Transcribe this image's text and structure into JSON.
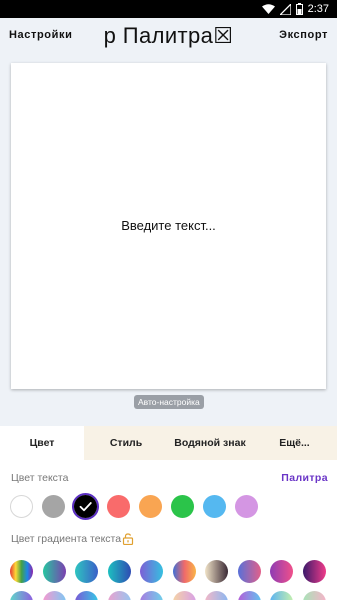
{
  "status_bar": {
    "time": "2:37"
  },
  "header": {
    "settings_label": "Настройки",
    "title": "р  Палитра☒",
    "export_label": "Экспорт"
  },
  "canvas": {
    "placeholder": "Введите текст...",
    "auto_badge": "Авто-настройка"
  },
  "tabs": [
    {
      "label": "Цвет",
      "active": true
    },
    {
      "label": "Стиль",
      "active": false
    },
    {
      "label": "Водяной знак",
      "active": false
    },
    {
      "label": "Ещё...",
      "active": false
    }
  ],
  "panel": {
    "text_color_label": "Цвет текста",
    "palette_link": "Палитра",
    "gradient_label": "Цвет градиента текста",
    "colors": [
      {
        "name": "white",
        "hex": "#ffffff"
      },
      {
        "name": "gray",
        "hex": "#a5a5a5"
      },
      {
        "name": "black",
        "hex": "#000000",
        "selected": true
      },
      {
        "name": "red",
        "hex": "#f96b6b"
      },
      {
        "name": "orange",
        "hex": "#f9a552"
      },
      {
        "name": "green",
        "hex": "#2bc44a"
      },
      {
        "name": "blue",
        "hex": "#55b8f0"
      },
      {
        "name": "lilac",
        "hex": "#d496e3"
      }
    ],
    "gradients_row1": [
      [
        "#e53935",
        "#fdd835",
        "#43a047",
        "#1e88e5",
        "#8e24aa"
      ],
      [
        "#26c6a0",
        "#7b3fb0"
      ],
      [
        "#2ec5c0",
        "#3a5fc8"
      ],
      [
        "#1dc0c0",
        "#2f4bb3"
      ],
      [
        "#7d5fd6",
        "#35c0e0"
      ],
      [
        "#3f6fd6",
        "#f06a6a",
        "#f9b548"
      ],
      [
        "#f1e3c8",
        "#3a2a35"
      ],
      [
        "#5870d8",
        "#e2608a"
      ],
      [
        "#8e3cb4",
        "#f0508a"
      ],
      [
        "#3b1a6a",
        "#f03b8a"
      ]
    ],
    "gradients_row2": [
      [
        "#5fd6c8",
        "#8e5fe0"
      ],
      [
        "#f59ad0",
        "#7fc6f2"
      ],
      [
        "#7a5ad6",
        "#35c7e6"
      ],
      [
        "#e9a2cf",
        "#98c5ef"
      ],
      [
        "#a67ce0",
        "#6fd0ea"
      ],
      [
        "#f5d3a6",
        "#d8a0e6"
      ],
      [
        "#f2b8c8",
        "#8cb7f0"
      ],
      [
        "#b45fd8",
        "#62c2f0"
      ],
      [
        "#5db3f0",
        "#c4f0ae"
      ],
      [
        "#a8e3b8",
        "#f5b3c8"
      ]
    ]
  }
}
